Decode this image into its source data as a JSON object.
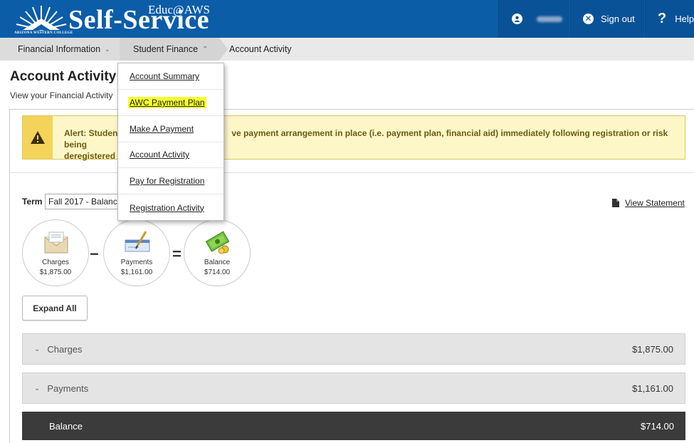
{
  "header": {
    "logo_main": "Self-Service",
    "logo_sup": "Educ@AWS",
    "logo_sub": "ARIZONA WESTERN COLLEGE",
    "sign_out": "Sign out",
    "help": "Help"
  },
  "breadcrumb": {
    "items": [
      "Financial Information",
      "Student Finance",
      "Account Activity"
    ]
  },
  "page": {
    "title": "Account Activity",
    "subtitle": "View your Financial Activity"
  },
  "alert": {
    "text_left": "Alert: Student",
    "text_right": "ve payment arrangement in place (i.e. payment plan, financial aid) immediately following registration or risk being",
    "text_line2": "deregistered f"
  },
  "term": {
    "label": "Term",
    "value": "Fall 2017 - Balance"
  },
  "view_statement": "View Statement",
  "summary": {
    "charges_label": "Charges",
    "charges_value": "$1,875.00",
    "payments_label": "Payments",
    "payments_value": "$1,161.00",
    "balance_label": "Balance",
    "balance_value": "$714.00",
    "minus": "−",
    "equals": "="
  },
  "expand_all": "Expand All",
  "sections": {
    "charges": {
      "label": "Charges",
      "amount": "$1,875.00"
    },
    "payments": {
      "label": "Payments",
      "amount": "$1,161.00"
    },
    "balance": {
      "label": "Balance",
      "amount": "$714.00"
    }
  },
  "dropdown": {
    "items": [
      "Account Summary",
      "AWC Payment Plan",
      "Make A Payment",
      "Account Activity",
      "Pay for Registration",
      "Registration Activity"
    ],
    "highlighted_index": 1,
    "highlight_color": "#f5ff33"
  },
  "colors": {
    "header_bg": "#0b5da8",
    "alert_bg": "#fdf7c8",
    "balance_bar": "#3b3b3b"
  }
}
